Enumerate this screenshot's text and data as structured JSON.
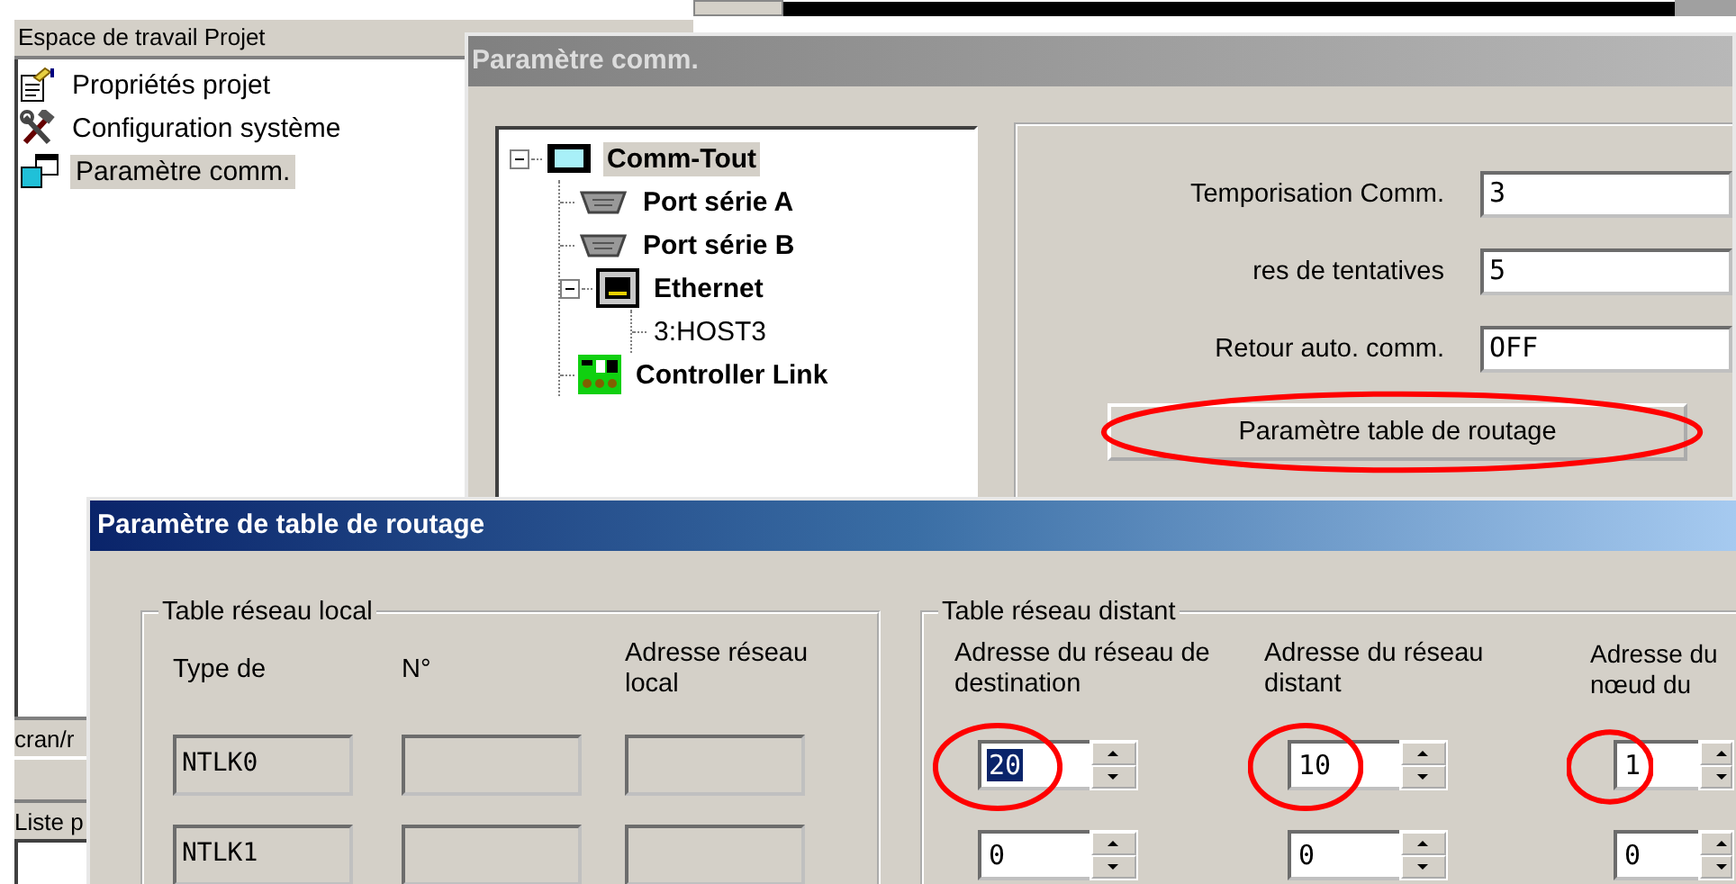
{
  "workspace": {
    "title": "Espace de travail Projet",
    "items": [
      {
        "label": "Propriétés projet",
        "kind": "properties",
        "selected": false
      },
      {
        "label": "Configuration système",
        "kind": "tools",
        "selected": false
      },
      {
        "label": "Paramètre comm.",
        "kind": "comm",
        "selected": true
      }
    ],
    "lower_tabs": [
      "cran/r",
      "Liste p"
    ]
  },
  "comm_window": {
    "title": "Paramètre comm.",
    "tree": [
      {
        "label": "Comm-Tout",
        "kind": "network",
        "selected": true,
        "expanded": true,
        "children": [
          {
            "label": "Port série A",
            "kind": "serial",
            "selected": false
          },
          {
            "label": "Port série B",
            "kind": "serial",
            "selected": false
          },
          {
            "label": "Ethernet",
            "kind": "ethernet",
            "selected": false,
            "expanded": true,
            "children": [
              {
                "label": "3:HOST3",
                "kind": "host",
                "selected": false
              }
            ]
          },
          {
            "label": "Controller Link",
            "kind": "controller-link",
            "selected": false
          }
        ]
      }
    ],
    "settings": [
      {
        "label": "Temporisation Comm.",
        "value": "3"
      },
      {
        "label": "res de tentatives",
        "value": "5"
      },
      {
        "label": "Retour auto. comm.",
        "value": "OFF"
      }
    ],
    "button": {
      "label": "Paramètre table de routage",
      "annotated": true
    }
  },
  "routing_dialog": {
    "title": "Paramètre de table de routage",
    "local_table": {
      "title": "Table réseau local",
      "columns": [
        "Type de",
        "N°",
        "Adresse réseau local"
      ],
      "rows": [
        {
          "type": "NTLK0"
        },
        {
          "type": "NTLK1"
        }
      ]
    },
    "distant_table": {
      "title": "Table réseau distant",
      "columns": [
        "Adresse du réseau de destination",
        "Adresse du réseau distant",
        "Adresse du nœud du"
      ],
      "rows": [
        {
          "cells": [
            {
              "value": "20",
              "selected": true,
              "annotated": true
            },
            {
              "value": "10",
              "selected": false,
              "annotated": true
            },
            {
              "value": "1",
              "selected": false,
              "annotated": true
            }
          ]
        },
        {
          "cells": [
            {
              "value": "0",
              "selected": false,
              "annotated": false
            },
            {
              "value": "0",
              "selected": false,
              "annotated": false
            },
            {
              "value": "0",
              "selected": false,
              "annotated": false
            }
          ]
        }
      ]
    }
  }
}
